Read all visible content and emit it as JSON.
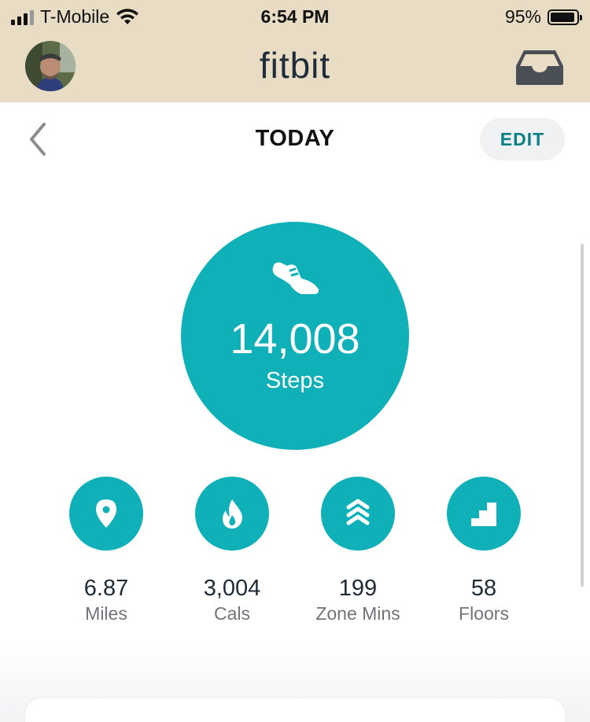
{
  "status_bar": {
    "carrier": "T-Mobile",
    "time": "6:54 PM",
    "battery_percent": "95%",
    "battery_level": 0.95,
    "icons": [
      "signal-icon",
      "wifi-icon",
      "battery-icon"
    ]
  },
  "app_bar": {
    "logo": "fitbit",
    "avatar_icon": "profile-photo",
    "inbox_icon": "inbox-icon"
  },
  "header": {
    "title": "TODAY",
    "back_icon": "chevron-left-icon",
    "edit_label": "EDIT"
  },
  "steps": {
    "value": "14,008",
    "label": "Steps",
    "icon": "shoe-icon"
  },
  "stats": [
    {
      "value": "6.87",
      "label": "Miles",
      "icon": "location-pin-icon"
    },
    {
      "value": "3,004",
      "label": "Cals",
      "icon": "flame-icon"
    },
    {
      "value": "199",
      "label": "Zone Mins",
      "icon": "zone-chevrons-icon"
    },
    {
      "value": "58",
      "label": "Floors",
      "icon": "stairs-icon"
    }
  ],
  "colors": {
    "accent": "#0fb0b7",
    "top_bar": "#e8dcc4",
    "edit_text": "#0a7f86"
  }
}
